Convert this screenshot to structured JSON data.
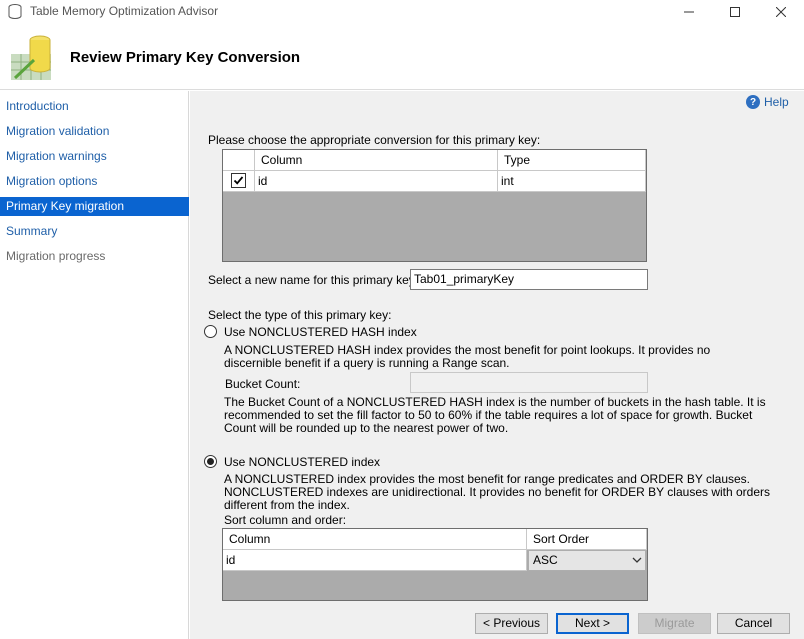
{
  "window": {
    "title": "Table Memory Optimization Advisor"
  },
  "header": {
    "title": "Review Primary Key Conversion"
  },
  "sidebar": {
    "items": [
      {
        "label": "Introduction"
      },
      {
        "label": "Migration validation"
      },
      {
        "label": "Migration warnings"
      },
      {
        "label": "Migration options"
      },
      {
        "label": "Primary Key migration"
      },
      {
        "label": "Summary"
      },
      {
        "label": "Migration progress"
      }
    ]
  },
  "help": {
    "label": "Help"
  },
  "conversion": {
    "prompt": "Please choose the appropriate conversion for this primary key:",
    "columns": [
      "Column",
      "Type"
    ],
    "rows": [
      {
        "checked": true,
        "column": "id",
        "type": "int"
      }
    ]
  },
  "pk_name": {
    "label": "Select a new name for this primary key:",
    "value": "Tab01_primaryKey"
  },
  "index_type": {
    "label": "Select the type of this primary key:",
    "hash": {
      "label": "Use NONCLUSTERED HASH index",
      "description": "A NONCLUSTERED HASH index provides the most benefit for point lookups. It provides no discernible benefit if a query is running a Range scan.",
      "bucket_label": "Bucket Count:",
      "bucket_value": "",
      "bucket_description": "The Bucket Count of a NONCLUSTERED HASH index is the number of buckets in the hash table. It is recommended to set the fill factor to 50 to 60% if the table requires a lot of space for growth. Bucket Count will be rounded up to the nearest power of two."
    },
    "nonclustered": {
      "label": "Use NONCLUSTERED index",
      "description": "A NONCLUSTERED index provides the most benefit for range predicates and ORDER BY clauses. NONCLUSTERED indexes are unidirectional. It provides no benefit for ORDER BY clauses with orders different from the index.",
      "sort_label": "Sort column and order:"
    },
    "selected": "nonclustered"
  },
  "sort_grid": {
    "columns": [
      "Column",
      "Sort Order"
    ],
    "rows": [
      {
        "column": "id",
        "order": "ASC"
      }
    ]
  },
  "buttons": {
    "previous": "< Previous",
    "next": "Next >",
    "migrate": "Migrate",
    "cancel": "Cancel"
  },
  "colors": {
    "accent": "#0a64d0",
    "link": "#1f5fa8",
    "panel": "#f0f0f0",
    "grid_empty": "#ababab"
  }
}
